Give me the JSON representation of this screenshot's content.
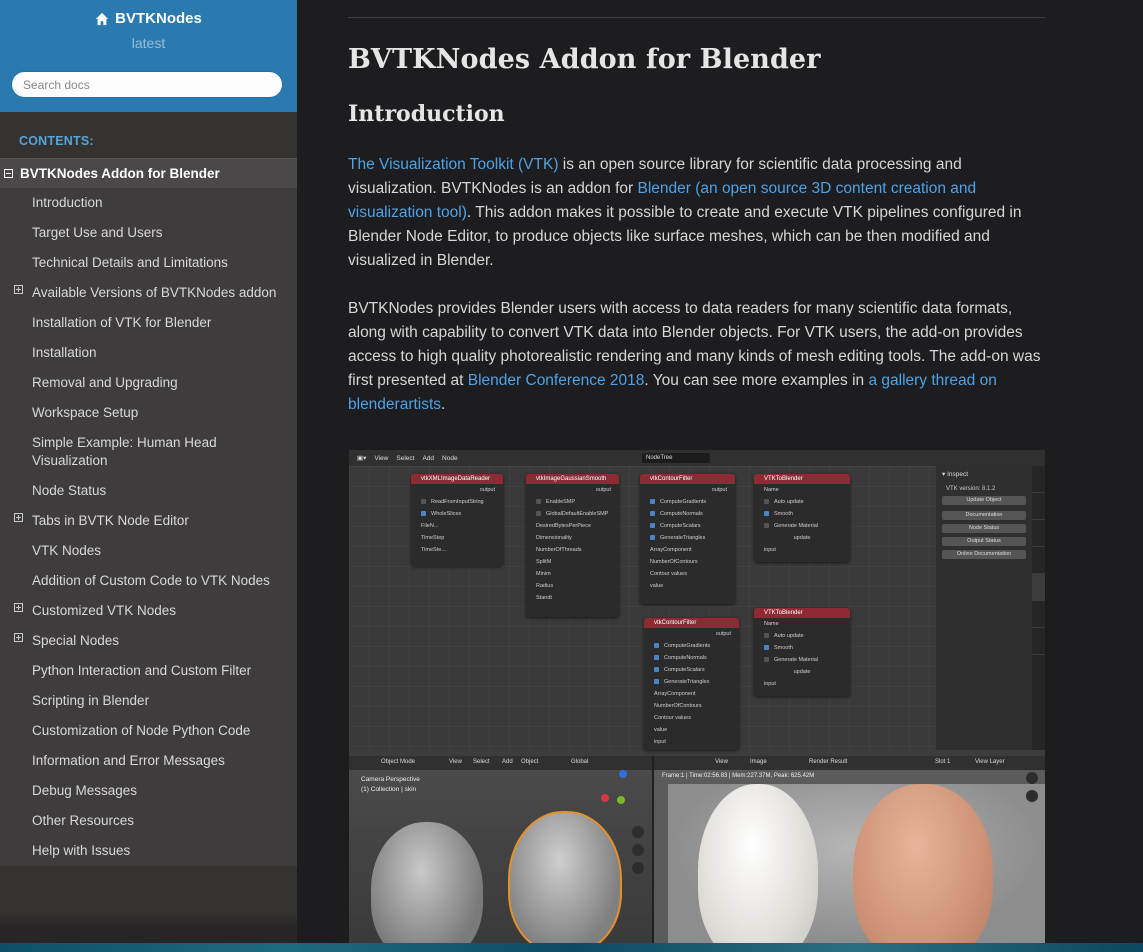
{
  "sidebar": {
    "brand": "BVTKNodes",
    "version": "latest",
    "search_placeholder": "Search docs",
    "caption": "CONTENTS:",
    "current": "BVTKNodes Addon for Blender",
    "items": [
      {
        "label": "Introduction",
        "expandable": false
      },
      {
        "label": "Target Use and Users",
        "expandable": false
      },
      {
        "label": "Technical Details and Limitations",
        "expandable": false
      },
      {
        "label": "Available Versions of BVTKNodes addon",
        "expandable": true
      },
      {
        "label": "Installation of VTK for Blender",
        "expandable": false
      },
      {
        "label": "Installation",
        "expandable": false
      },
      {
        "label": "Removal and Upgrading",
        "expandable": false
      },
      {
        "label": "Workspace Setup",
        "expandable": false
      },
      {
        "label": "Simple Example: Human Head Visualization",
        "expandable": false
      },
      {
        "label": "Node Status",
        "expandable": false
      },
      {
        "label": "Tabs in BVTK Node Editor",
        "expandable": true
      },
      {
        "label": "VTK Nodes",
        "expandable": false
      },
      {
        "label": "Addition of Custom Code to VTK Nodes",
        "expandable": false
      },
      {
        "label": "Customized VTK Nodes",
        "expandable": true
      },
      {
        "label": "Special Nodes",
        "expandable": true
      },
      {
        "label": "Python Interaction and Custom Filter",
        "expandable": false
      },
      {
        "label": "Scripting in Blender",
        "expandable": false
      },
      {
        "label": "Customization of Node Python Code",
        "expandable": false
      },
      {
        "label": "Information and Error Messages",
        "expandable": false
      },
      {
        "label": "Debug Messages",
        "expandable": false
      },
      {
        "label": "Other Resources",
        "expandable": false
      },
      {
        "label": "Help with Issues",
        "expandable": false
      }
    ]
  },
  "content": {
    "h1": "BVTKNodes Addon for Blender",
    "h2": "Introduction",
    "p1": {
      "link1": "The Visualization Toolkit (VTK)",
      "t1": " is an open source library for scientific data processing and visualization. BVTKNodes is an addon for ",
      "link2": "Blender (an open source 3D content creation and visualization tool)",
      "t2": ". This addon makes it possible to create and execute VTK pipelines configured in Blender Node Editor, to produce objects like surface meshes, which can be then modified and visualized in Blender."
    },
    "p2": {
      "t1": "BVTKNodes provides Blender users with access to data readers for many scientific data formats, along with capability to convert VTK data into Blender objects. For VTK users, the add-on provides access to high quality photorealistic rendering and many kinds of mesh editing tools. The add-on was first presented at ",
      "link1": "Blender Conference 2018",
      "t2": ". You can see more examples in ",
      "link2": "a gallery thread on blenderartists",
      "t3": "."
    }
  },
  "figure": {
    "node_editor": {
      "menus": [
        "View",
        "Select",
        "Add",
        "Node"
      ],
      "tree": "NodeTree",
      "nodes": [
        {
          "title": "vtkXMLImageDataReader",
          "rows": [
            "output",
            "ReadFromInputString",
            "WholeSlices",
            "FileN...",
            "TimeStep",
            "TimeSte...",
            "ReaderErrorObserver"
          ]
        },
        {
          "title": "vtkImageGaussianSmooth",
          "rows": [
            "output",
            "EnableSMP",
            "GlobalDefaultEnableSMP",
            "DesiredBytesPerPiece",
            "Dimensionality",
            "NumberOfThreads",
            "SplitM",
            "Minim",
            "Radius",
            "Standt",
            "input"
          ]
        },
        {
          "title": "vtkContourFilter",
          "rows": [
            "output",
            "ComputeGradients",
            "ComputeNormals",
            "ComputeScalars",
            "GenerateTriangles",
            "ArrayComponent",
            "NumberOfContours",
            "Contour values",
            "value",
            "input"
          ]
        },
        {
          "title": "VTKToBlender",
          "rows": [
            "Name",
            "Auto update",
            "Smooth",
            "Generate Material",
            "update",
            "input"
          ]
        },
        {
          "title": "vtkContourFilter",
          "rows": [
            "output",
            "ComputeGradients",
            "ComputeNormals",
            "ComputeScalars",
            "GenerateTriangles",
            "ArrayComponent",
            "NumberOfContours",
            "Contour values",
            "value",
            "input"
          ]
        },
        {
          "title": "VTKToBlender",
          "rows": [
            "Name",
            "Auto update",
            "Smooth",
            "Generate Material",
            "update",
            "input"
          ]
        }
      ],
      "panel": {
        "title": "Inspect",
        "version": "VTK version: 8.1.2",
        "buttons": [
          "Update Object",
          "Documentation",
          "Node Status",
          "Output Status",
          "Online Documentation"
        ]
      }
    },
    "viewport": {
      "mode": "Object Mode",
      "menus": [
        "View",
        "Select",
        "Add",
        "Object"
      ],
      "transform": "Global",
      "line1": "Camera Perspective",
      "line2": "(1) Collection | skin"
    },
    "image_editor": {
      "menus": [
        "View",
        "Image"
      ],
      "render": "Render Result",
      "slot": "Slot 1",
      "layer": "View Layer",
      "stats": "Frame:1 | Time:02:56.83 | Mem:227.37M, Peak: 625.42M"
    }
  },
  "colors": {
    "sidebar_top": "#2a7ab0",
    "sidebar_bg": "#343131",
    "link": "#4ea2e6",
    "caption": "#55a5d9"
  }
}
